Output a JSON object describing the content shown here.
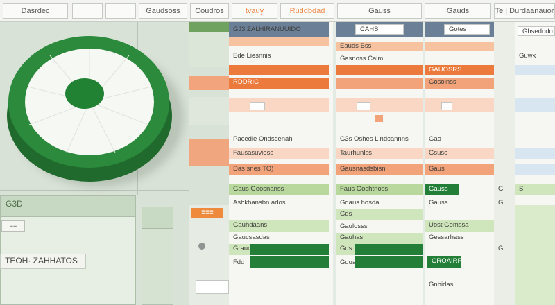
{
  "toolbar": {
    "btn1": "Dasrdec",
    "btn2": "",
    "btn3": "",
    "btn4": "Gaudsoss",
    "btn5": "Coudros",
    "btn6": "tvauy",
    "btn7": "Ruddbdad",
    "btn8": "Gauss",
    "btn9": "Gauds",
    "btn10": "Te | Durdaanauor"
  },
  "left": {
    "label_top": "G3D",
    "label_bottom": "TEOH·  ZAHHATOS",
    "small_btn": "≡≡",
    "orange_btn": "≡≡≡"
  },
  "columns": {
    "c1": {
      "hdr": "GJ3  ZALHIRANUUIDO",
      "r1": "Ede Liesnnis",
      "r2": "RDDRIC",
      "r3": "Pacedle Ondscenah",
      "r4": "Fausasuvioss",
      "r5": "Das snes  TO)",
      "r6": "Gaus Geosnanss",
      "r7": "Asbkhansbn ados",
      "r8": "Gauhdaans",
      "r9": "Gaucsasdas",
      "r10": "Graud",
      "r11": "Fdd"
    },
    "c2": {
      "hdr": "CAHS",
      "r1": "Eauds Bss",
      "r2": "Gasnoss Calm",
      "r3": "G3s  Oshes Lindcannns",
      "r4": "Taurhunlss",
      "r5": "Gausnasdsbisn",
      "r6": "Faus Goshtnoss",
      "r7": "Gdaus hosda",
      "r8": "Gds",
      "r9": "Gaulosss",
      "r10": "Gauhas",
      "r11": "Gds",
      "r12": "Gdua"
    },
    "c3": {
      "hdr": "Gotes",
      "r1": "GAUOSRS",
      "r2": "Gosoinss",
      "r3": "Gao",
      "r4": "Gsuso",
      "r5": "Gaus",
      "r6": "Gauss",
      "r7": "Gauss",
      "r8": "Uost Gomssa",
      "r9": "Gessarhass",
      "r10": "GROAIRROS",
      "r11": "Gnbidas"
    },
    "c4": {
      "r1": "Ghsedodo",
      "r2": "Guwk",
      "r3": "G",
      "r4": "S",
      "r5": "G",
      "r6": "G"
    }
  },
  "colors": {
    "green": "#237f38",
    "orange": "#ec7a3c",
    "blue": "#6b7f97"
  }
}
